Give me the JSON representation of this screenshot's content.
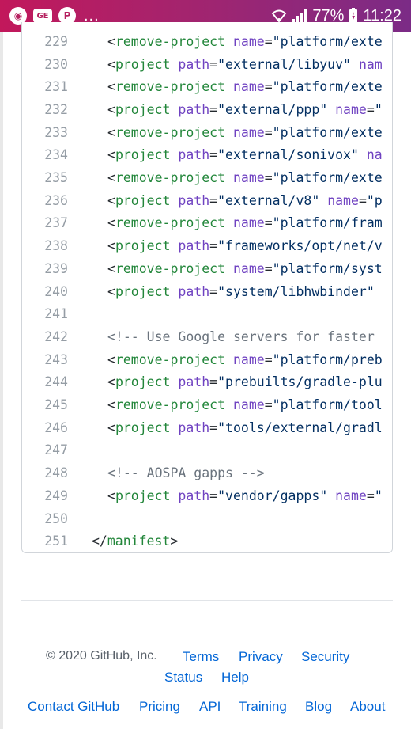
{
  "status_bar": {
    "left_icons": [
      "firefox-icon",
      "ge-icon",
      "pinterest-icon"
    ],
    "ge_label": "GE",
    "overflow": "...",
    "battery_percent": "77%",
    "time": "11:22"
  },
  "code": {
    "lines": [
      {
        "num": "229",
        "tokens": [
          {
            "t": "<",
            "k": "pun"
          },
          {
            "t": "remove-project",
            "k": "tag"
          },
          {
            "t": " ",
            "k": "pun"
          },
          {
            "t": "name",
            "k": "attr"
          },
          {
            "t": "=",
            "k": "pun"
          },
          {
            "t": "\"platform/exte",
            "k": "str"
          }
        ]
      },
      {
        "num": "230",
        "tokens": [
          {
            "t": "<",
            "k": "pun"
          },
          {
            "t": "project",
            "k": "tag"
          },
          {
            "t": " ",
            "k": "pun"
          },
          {
            "t": "path",
            "k": "attr"
          },
          {
            "t": "=",
            "k": "pun"
          },
          {
            "t": "\"external/libyuv\"",
            "k": "str"
          },
          {
            "t": " ",
            "k": "pun"
          },
          {
            "t": "nam",
            "k": "attr"
          }
        ]
      },
      {
        "num": "231",
        "tokens": [
          {
            "t": "<",
            "k": "pun"
          },
          {
            "t": "remove-project",
            "k": "tag"
          },
          {
            "t": " ",
            "k": "pun"
          },
          {
            "t": "name",
            "k": "attr"
          },
          {
            "t": "=",
            "k": "pun"
          },
          {
            "t": "\"platform/exte",
            "k": "str"
          }
        ]
      },
      {
        "num": "232",
        "tokens": [
          {
            "t": "<",
            "k": "pun"
          },
          {
            "t": "project",
            "k": "tag"
          },
          {
            "t": " ",
            "k": "pun"
          },
          {
            "t": "path",
            "k": "attr"
          },
          {
            "t": "=",
            "k": "pun"
          },
          {
            "t": "\"external/ppp\"",
            "k": "str"
          },
          {
            "t": " ",
            "k": "pun"
          },
          {
            "t": "name",
            "k": "attr"
          },
          {
            "t": "=",
            "k": "pun"
          },
          {
            "t": "\"",
            "k": "str"
          }
        ]
      },
      {
        "num": "233",
        "tokens": [
          {
            "t": "<",
            "k": "pun"
          },
          {
            "t": "remove-project",
            "k": "tag"
          },
          {
            "t": " ",
            "k": "pun"
          },
          {
            "t": "name",
            "k": "attr"
          },
          {
            "t": "=",
            "k": "pun"
          },
          {
            "t": "\"platform/exte",
            "k": "str"
          }
        ]
      },
      {
        "num": "234",
        "tokens": [
          {
            "t": "<",
            "k": "pun"
          },
          {
            "t": "project",
            "k": "tag"
          },
          {
            "t": " ",
            "k": "pun"
          },
          {
            "t": "path",
            "k": "attr"
          },
          {
            "t": "=",
            "k": "pun"
          },
          {
            "t": "\"external/sonivox\"",
            "k": "str"
          },
          {
            "t": " ",
            "k": "pun"
          },
          {
            "t": "na",
            "k": "attr"
          }
        ]
      },
      {
        "num": "235",
        "tokens": [
          {
            "t": "<",
            "k": "pun"
          },
          {
            "t": "remove-project",
            "k": "tag"
          },
          {
            "t": " ",
            "k": "pun"
          },
          {
            "t": "name",
            "k": "attr"
          },
          {
            "t": "=",
            "k": "pun"
          },
          {
            "t": "\"platform/exte",
            "k": "str"
          }
        ]
      },
      {
        "num": "236",
        "tokens": [
          {
            "t": "<",
            "k": "pun"
          },
          {
            "t": "project",
            "k": "tag"
          },
          {
            "t": " ",
            "k": "pun"
          },
          {
            "t": "path",
            "k": "attr"
          },
          {
            "t": "=",
            "k": "pun"
          },
          {
            "t": "\"external/v8\"",
            "k": "str"
          },
          {
            "t": " ",
            "k": "pun"
          },
          {
            "t": "name",
            "k": "attr"
          },
          {
            "t": "=",
            "k": "pun"
          },
          {
            "t": "\"p",
            "k": "str"
          }
        ]
      },
      {
        "num": "237",
        "tokens": [
          {
            "t": "<",
            "k": "pun"
          },
          {
            "t": "remove-project",
            "k": "tag"
          },
          {
            "t": " ",
            "k": "pun"
          },
          {
            "t": "name",
            "k": "attr"
          },
          {
            "t": "=",
            "k": "pun"
          },
          {
            "t": "\"platform/fram",
            "k": "str"
          }
        ]
      },
      {
        "num": "238",
        "tokens": [
          {
            "t": "<",
            "k": "pun"
          },
          {
            "t": "project",
            "k": "tag"
          },
          {
            "t": " ",
            "k": "pun"
          },
          {
            "t": "path",
            "k": "attr"
          },
          {
            "t": "=",
            "k": "pun"
          },
          {
            "t": "\"frameworks/opt/net/v",
            "k": "str"
          }
        ]
      },
      {
        "num": "239",
        "tokens": [
          {
            "t": "<",
            "k": "pun"
          },
          {
            "t": "remove-project",
            "k": "tag"
          },
          {
            "t": " ",
            "k": "pun"
          },
          {
            "t": "name",
            "k": "attr"
          },
          {
            "t": "=",
            "k": "pun"
          },
          {
            "t": "\"platform/syst",
            "k": "str"
          }
        ]
      },
      {
        "num": "240",
        "tokens": [
          {
            "t": "<",
            "k": "pun"
          },
          {
            "t": "project",
            "k": "tag"
          },
          {
            "t": " ",
            "k": "pun"
          },
          {
            "t": "path",
            "k": "attr"
          },
          {
            "t": "=",
            "k": "pun"
          },
          {
            "t": "\"system/libhwbinder\"",
            "k": "str"
          }
        ]
      },
      {
        "num": "241",
        "tokens": []
      },
      {
        "num": "242",
        "tokens": [
          {
            "t": "<!-- Use Google servers for faster",
            "k": "com"
          }
        ]
      },
      {
        "num": "243",
        "tokens": [
          {
            "t": "<",
            "k": "pun"
          },
          {
            "t": "remove-project",
            "k": "tag"
          },
          {
            "t": " ",
            "k": "pun"
          },
          {
            "t": "name",
            "k": "attr"
          },
          {
            "t": "=",
            "k": "pun"
          },
          {
            "t": "\"platform/preb",
            "k": "str"
          }
        ]
      },
      {
        "num": "244",
        "tokens": [
          {
            "t": "<",
            "k": "pun"
          },
          {
            "t": "project",
            "k": "tag"
          },
          {
            "t": " ",
            "k": "pun"
          },
          {
            "t": "path",
            "k": "attr"
          },
          {
            "t": "=",
            "k": "pun"
          },
          {
            "t": "\"prebuilts/gradle-plu",
            "k": "str"
          }
        ]
      },
      {
        "num": "245",
        "tokens": [
          {
            "t": "<",
            "k": "pun"
          },
          {
            "t": "remove-project",
            "k": "tag"
          },
          {
            "t": " ",
            "k": "pun"
          },
          {
            "t": "name",
            "k": "attr"
          },
          {
            "t": "=",
            "k": "pun"
          },
          {
            "t": "\"platform/tool",
            "k": "str"
          }
        ]
      },
      {
        "num": "246",
        "tokens": [
          {
            "t": "<",
            "k": "pun"
          },
          {
            "t": "project",
            "k": "tag"
          },
          {
            "t": " ",
            "k": "pun"
          },
          {
            "t": "path",
            "k": "attr"
          },
          {
            "t": "=",
            "k": "pun"
          },
          {
            "t": "\"tools/external/gradl",
            "k": "str"
          }
        ]
      },
      {
        "num": "247",
        "tokens": []
      },
      {
        "num": "248",
        "tokens": [
          {
            "t": "<!-- AOSPA gapps -->",
            "k": "com"
          }
        ]
      },
      {
        "num": "249",
        "tokens": [
          {
            "t": "<",
            "k": "pun"
          },
          {
            "t": "project",
            "k": "tag"
          },
          {
            "t": " ",
            "k": "pun"
          },
          {
            "t": "path",
            "k": "attr"
          },
          {
            "t": "=",
            "k": "pun"
          },
          {
            "t": "\"vendor/gapps\"",
            "k": "str"
          },
          {
            "t": " ",
            "k": "pun"
          },
          {
            "t": "name",
            "k": "attr"
          },
          {
            "t": "=",
            "k": "pun"
          },
          {
            "t": "\"",
            "k": "str"
          }
        ]
      },
      {
        "num": "250",
        "tokens": []
      },
      {
        "num": "251",
        "indent0": true,
        "tokens": [
          {
            "t": "</",
            "k": "pun"
          },
          {
            "t": "manifest",
            "k": "tag"
          },
          {
            "t": ">",
            "k": "pun"
          }
        ]
      }
    ]
  },
  "footer": {
    "copyright": "© 2020 GitHub, Inc.",
    "links": {
      "terms": "Terms",
      "privacy": "Privacy",
      "security": "Security",
      "status": "Status",
      "help": "Help",
      "contact": "Contact GitHub",
      "pricing": "Pricing",
      "api": "API",
      "training": "Training",
      "blog": "Blog",
      "about": "About"
    }
  }
}
